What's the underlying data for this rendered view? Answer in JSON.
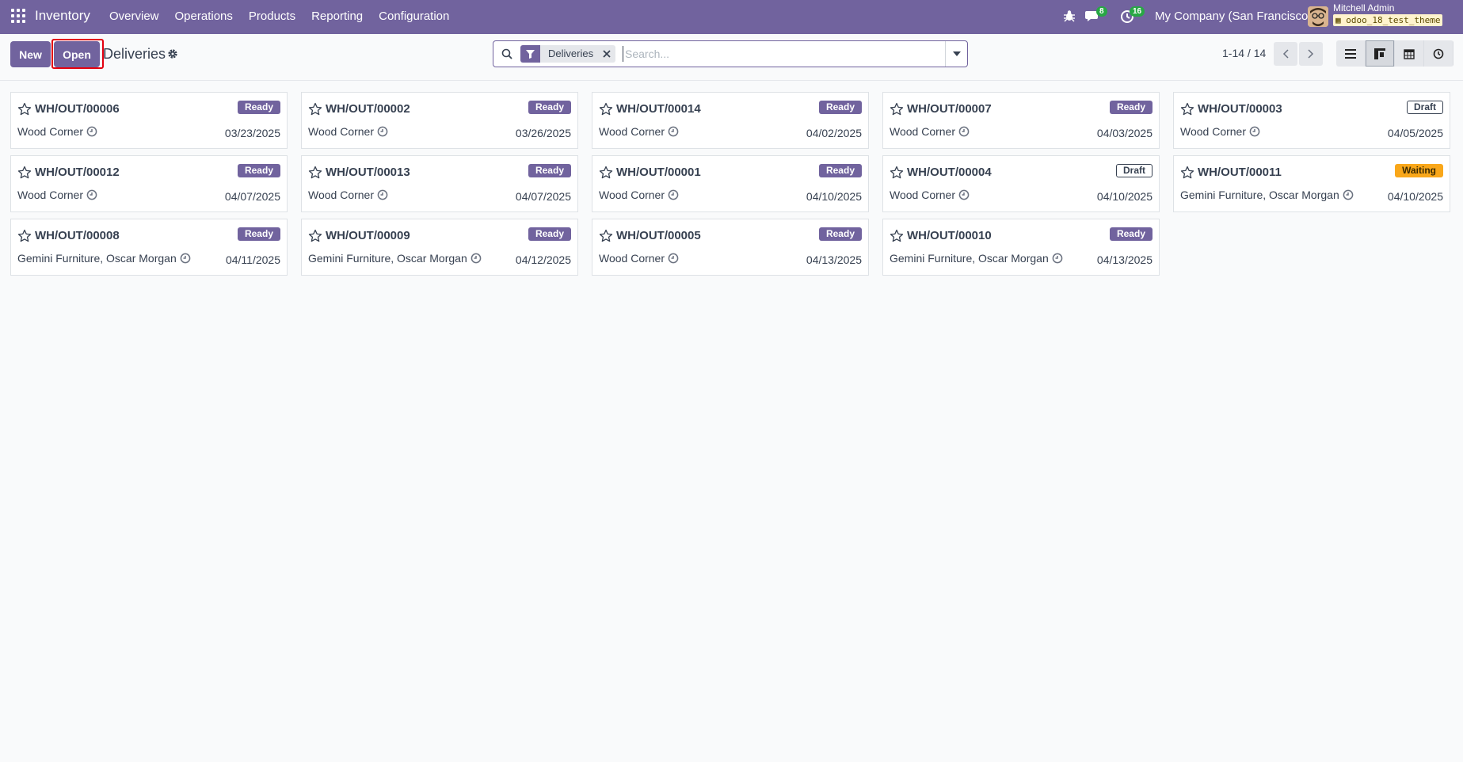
{
  "navbar": {
    "brand": "Inventory",
    "menu": [
      "Overview",
      "Operations",
      "Products",
      "Reporting",
      "Configuration"
    ],
    "chat_count": "8",
    "activity_count": "16",
    "company": "My Company (San Francisco)",
    "user_name": "Mitchell Admin",
    "database": "odoo_18_test_theme"
  },
  "control": {
    "new_label": "New",
    "open_label": "Open",
    "breadcrumb": "Deliveries",
    "facet_label": "Deliveries",
    "search_placeholder": "Search...",
    "pager": "1-14 / 14"
  },
  "colors": {
    "brand": "#71639e",
    "ready": "#71639e",
    "waiting": "#f9a71a",
    "highlight": "#e3000f"
  },
  "cards": [
    {
      "ref": "WH/OUT/00006",
      "status": "Ready",
      "partner": "Wood Corner",
      "date": "03/23/2025"
    },
    {
      "ref": "WH/OUT/00002",
      "status": "Ready",
      "partner": "Wood Corner",
      "date": "03/26/2025"
    },
    {
      "ref": "WH/OUT/00014",
      "status": "Ready",
      "partner": "Wood Corner",
      "date": "04/02/2025"
    },
    {
      "ref": "WH/OUT/00007",
      "status": "Ready",
      "partner": "Wood Corner",
      "date": "04/03/2025"
    },
    {
      "ref": "WH/OUT/00003",
      "status": "Draft",
      "partner": "Wood Corner",
      "date": "04/05/2025"
    },
    {
      "ref": "WH/OUT/00012",
      "status": "Ready",
      "partner": "Wood Corner",
      "date": "04/07/2025"
    },
    {
      "ref": "WH/OUT/00013",
      "status": "Ready",
      "partner": "Wood Corner",
      "date": "04/07/2025"
    },
    {
      "ref": "WH/OUT/00001",
      "status": "Ready",
      "partner": "Wood Corner",
      "date": "04/10/2025"
    },
    {
      "ref": "WH/OUT/00004",
      "status": "Draft",
      "partner": "Wood Corner",
      "date": "04/10/2025"
    },
    {
      "ref": "WH/OUT/00011",
      "status": "Waiting",
      "partner": "Gemini Furniture, Oscar Morgan",
      "date": "04/10/2025"
    },
    {
      "ref": "WH/OUT/00008",
      "status": "Ready",
      "partner": "Gemini Furniture, Oscar Morgan",
      "date": "04/11/2025"
    },
    {
      "ref": "WH/OUT/00009",
      "status": "Ready",
      "partner": "Gemini Furniture, Oscar Morgan",
      "date": "04/12/2025"
    },
    {
      "ref": "WH/OUT/00005",
      "status": "Ready",
      "partner": "Wood Corner",
      "date": "04/13/2025"
    },
    {
      "ref": "WH/OUT/00010",
      "status": "Ready",
      "partner": "Gemini Furniture, Oscar Morgan",
      "date": "04/13/2025"
    }
  ]
}
